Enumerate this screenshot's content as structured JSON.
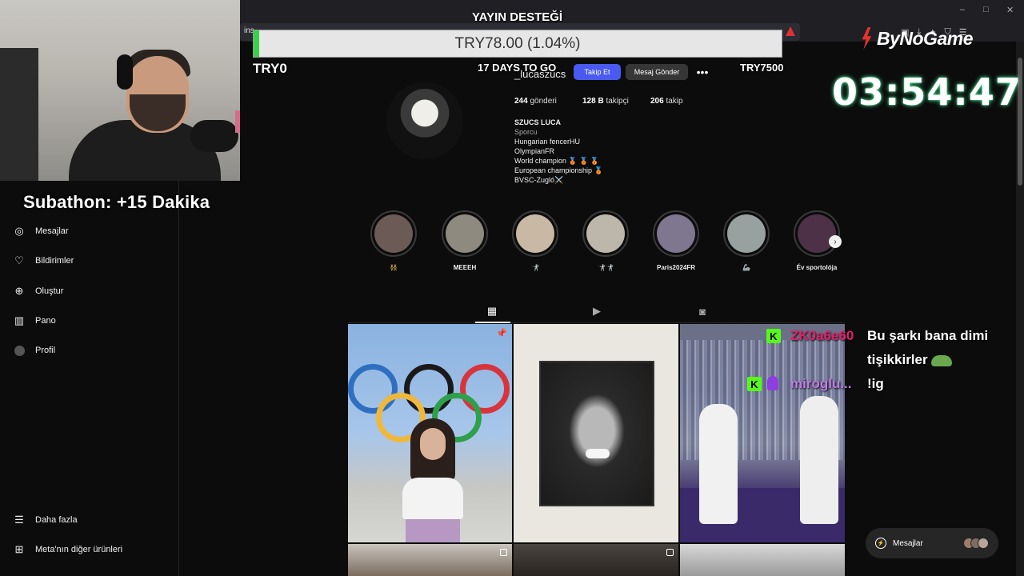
{
  "browser": {
    "url_prefix": "ins",
    "window_controls": [
      "–",
      "□",
      "✕"
    ]
  },
  "donation": {
    "title": "YAYIN DESTEĞİ",
    "current": "TRY78.00 (1.04%)",
    "progress_percent": 1.04,
    "min_label": "TRY0",
    "days_label": "17 DAYS TO GO",
    "max_label": "TRY7500"
  },
  "stream": {
    "subathon": "Subathon: +15 Dakika",
    "brand": "ByNoGame",
    "timer": "03:54:47"
  },
  "sidebar": {
    "items": [
      {
        "label": "Mesajlar",
        "icon": "messenger-icon"
      },
      {
        "label": "Bildirimler",
        "icon": "heart-icon"
      },
      {
        "label": "Oluştur",
        "icon": "plus-square-icon"
      },
      {
        "label": "Pano",
        "icon": "dashboard-icon"
      },
      {
        "label": "Profil",
        "icon": "profile-avatar-icon"
      },
      {
        "label": "Daha fazla",
        "icon": "menu-icon"
      },
      {
        "label": "Meta'nın diğer ürünleri",
        "icon": "meta-products-icon"
      }
    ]
  },
  "profile": {
    "username": "_lucaszucs",
    "follow_label": "Takip Et",
    "message_label": "Mesaj Gönder",
    "more_label": "•••",
    "stats": {
      "posts_value": "244",
      "posts_label": "gönderi",
      "followers_value": "128 B",
      "followers_label": "takipçi",
      "following_value": "206",
      "following_label": "takip"
    },
    "bio": {
      "name": "SZUCS LUCA",
      "category": "Sporcu",
      "lines": [
        "Hungarian fencerHU",
        "OlympianFR",
        "World champion 🥉 🥉 🥉",
        "European championship 🥉",
        "BVSC-Zugló⚔️"
      ]
    }
  },
  "highlights": [
    {
      "label": "👯",
      "color": "#6b5a56"
    },
    {
      "label": "MEEEH",
      "color": "#8e8a80"
    },
    {
      "label": "🤺",
      "color": "#c9b8a4"
    },
    {
      "label": "🤺🤺",
      "color": "#bdb7ab"
    },
    {
      "label": "Paris2024FR",
      "color": "#7f7690"
    },
    {
      "label": "🦾",
      "color": "#98a0a0"
    },
    {
      "label": "Év sportolója",
      "color": "#4d3247"
    }
  ],
  "tabs": [
    {
      "name": "posts",
      "icon": "grid-icon",
      "glyph": "▦"
    },
    {
      "name": "reels",
      "icon": "reels-icon",
      "glyph": "▶"
    },
    {
      "name": "tagged",
      "icon": "tagged-icon",
      "glyph": "◙"
    }
  ],
  "chat": {
    "user1": "ZK0a6e60",
    "message1_line1": "Bu şarkı bana dimi",
    "message1_line2": "tişikkirler",
    "user2": "miroglu...",
    "message2": "!ig"
  },
  "messages_pill": {
    "label": "Mesajlar"
  },
  "colors": {
    "accent_blue": "#4a5af0",
    "progress_green": "#37d24a",
    "kick_green": "#53fc18",
    "timer_glow": "#4fe89a"
  }
}
